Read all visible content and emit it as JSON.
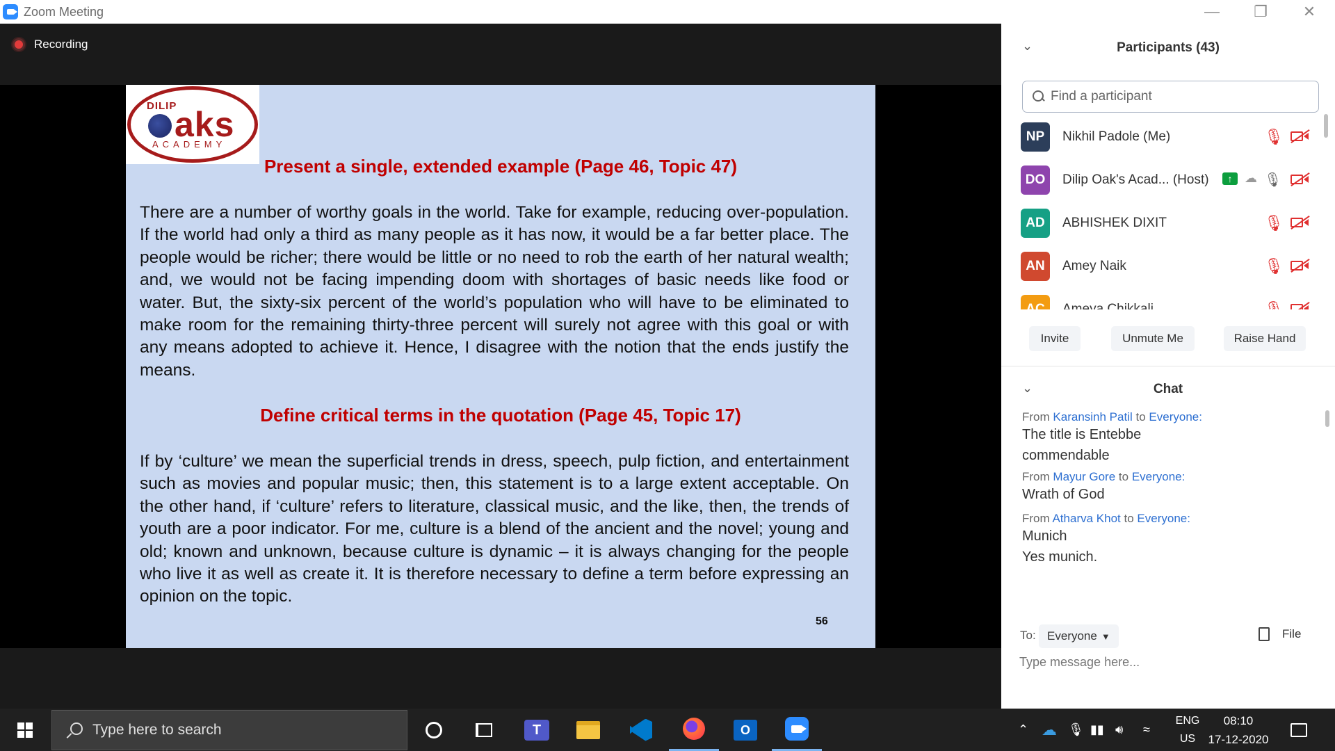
{
  "window": {
    "title": "Zoom Meeting"
  },
  "meeting": {
    "recording_label": "Recording",
    "slide": {
      "logo": {
        "top": "DILIP",
        "main": "aks",
        "bottom": "ACADEMY"
      },
      "heading1": "Present a single, extended example (Page 46, Topic 47)",
      "paragraph1": "There are a number of worthy goals in the world. Take for example, reducing over-population. If the world had only a third as many people as it has now, it would be a far better place. The people would be richer; there would be little or no need to rob the earth of her natural wealth; and, we would not be facing impending doom with shortages of basic needs like food or water. But, the sixty-six percent of the world’s population who will have to be eliminated to make room for the remaining thirty-three percent will surely not agree with this goal or with any means adopted to achieve it. Hence, I disagree with the notion that the ends justify the means.",
      "heading2": "Define critical terms in the quotation (Page 45, Topic 17)",
      "paragraph2": "If by ‘culture’ we mean the superficial trends in dress, speech, pulp fiction, and entertainment such as movies and popular music; then, this statement is to a large extent acceptable. On the other hand, if ‘culture’ refers to literature, classical music, and the like, then, the trends of youth are a poor indicator. For me, culture is a blend of the ancient and the novel; young and old; known and unknown, because culture is dynamic – it is always changing for the people who live it as well as create it. It is therefore necessary to define a term before expressing an opinion on the topic.",
      "page_number": "56"
    }
  },
  "participants": {
    "title": "Participants (43)",
    "search_placeholder": "Find a participant",
    "list": [
      {
        "initials": "NP",
        "name": "Nikhil Padole (Me)",
        "color": "#2c3e5a",
        "mic": "muted"
      },
      {
        "initials": "DO",
        "name": "Dilip Oak's Acad...  (Host)",
        "color": "#8e44ad",
        "mic": "on"
      },
      {
        "initials": "AD",
        "name": "ABHISHEK DIXIT",
        "color": "#16a085",
        "mic": "muted"
      },
      {
        "initials": "AN",
        "name": "Amey Naik",
        "color": "#d0492f",
        "mic": "muted"
      },
      {
        "initials": "AC",
        "name": "Ameya Chikkali",
        "color": "#f39c12",
        "mic": "muted"
      }
    ],
    "buttons": {
      "invite": "Invite",
      "unmute": "Unmute Me",
      "raise_hand": "Raise Hand"
    }
  },
  "chat": {
    "title": "Chat",
    "messages": [
      {
        "from": "Karansinh Patil",
        "to": "Everyone",
        "lines": [
          "The title is Entebbe",
          "commendable"
        ]
      },
      {
        "from": "Mayur Gore",
        "to": "Everyone",
        "lines": [
          "Wrath of God"
        ]
      },
      {
        "from": "Atharva Khot",
        "to": "Everyone",
        "lines": [
          "Munich",
          "Yes munich."
        ]
      }
    ],
    "from_word": "From",
    "to_word": "to",
    "to_label": "To:",
    "to_value": "Everyone",
    "file_label": "File",
    "input_placeholder": "Type message here..."
  },
  "taskbar": {
    "search_placeholder": "Type here to search",
    "apps": [
      "cortana-icon",
      "task-view-icon",
      "teams-icon",
      "file-explorer-icon",
      "vscode-icon",
      "firefox-icon",
      "outlook-icon",
      "zoom-icon"
    ],
    "lang_top": "ENG",
    "lang_bottom": "US",
    "time": "08:10",
    "date": "17-12-2020"
  },
  "colors": {
    "accent": "#2d8cff",
    "heading_red": "#c00000",
    "slide_bg": "#c9d8f1",
    "muted_red": "#e03030"
  }
}
